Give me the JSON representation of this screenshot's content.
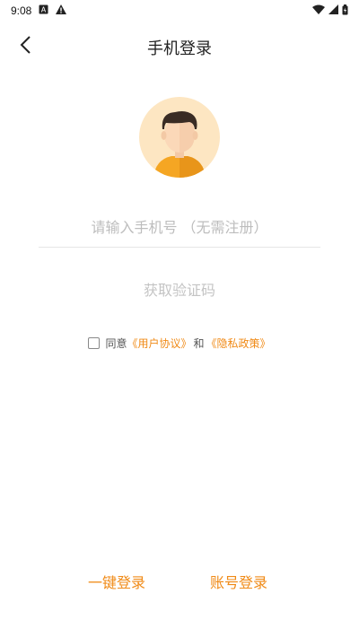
{
  "status_bar": {
    "time": "9:08",
    "left_icons": [
      "a-letter-icon",
      "warning-icon"
    ],
    "right_icons": [
      "wifi-icon",
      "signal-icon",
      "battery-icon"
    ]
  },
  "nav": {
    "back_icon": "chevron-left-icon",
    "title": "手机登录"
  },
  "avatar": {
    "icon": "user-avatar-icon",
    "colors": {
      "background": "#fde6c2",
      "hair": "#3a2c24",
      "skin": "#fbd8b8",
      "shirt": "#f5a623"
    }
  },
  "form": {
    "phone_placeholder": "请输入手机号 （无需注册）",
    "phone_value": "",
    "get_code_label": "获取验证码"
  },
  "agreement": {
    "checked": false,
    "prefix": "同意",
    "user_agreement": "《用户协议》",
    "conjunction": "和",
    "privacy_policy": "《隐私政策》"
  },
  "bottom": {
    "quick_login": "一键登录",
    "account_login": "账号登录"
  },
  "colors": {
    "accent": "#f08a16",
    "placeholder": "#bdbdbd",
    "background": "#ffffff"
  }
}
